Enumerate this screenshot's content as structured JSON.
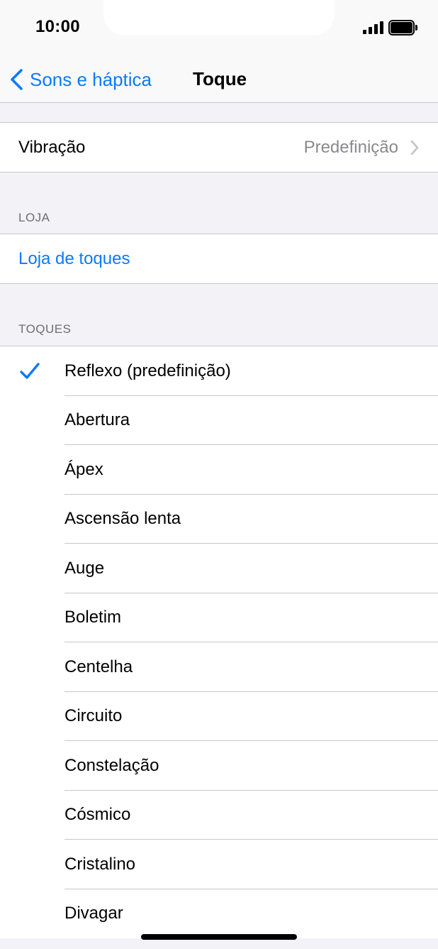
{
  "status_bar": {
    "time": "10:00"
  },
  "nav": {
    "back_label": "Sons e háptica",
    "title": "Toque"
  },
  "vibration": {
    "label": "Vibração",
    "value": "Predefinição"
  },
  "store": {
    "header": "LOJA",
    "link": "Loja de toques"
  },
  "tones": {
    "header": "TOQUES",
    "items": [
      {
        "label": "Reflexo (predefinição)",
        "selected": true
      },
      {
        "label": "Abertura",
        "selected": false
      },
      {
        "label": "Ápex",
        "selected": false
      },
      {
        "label": "Ascensão lenta",
        "selected": false
      },
      {
        "label": "Auge",
        "selected": false
      },
      {
        "label": "Boletim",
        "selected": false
      },
      {
        "label": "Centelha",
        "selected": false
      },
      {
        "label": "Circuito",
        "selected": false
      },
      {
        "label": "Constelação",
        "selected": false
      },
      {
        "label": "Cósmico",
        "selected": false
      },
      {
        "label": "Cristalino",
        "selected": false
      },
      {
        "label": "Divagar",
        "selected": false
      }
    ]
  },
  "colors": {
    "accent": "#0a7aff",
    "secondary_text": "#8a8a8e",
    "background": "#f2f2f7"
  }
}
